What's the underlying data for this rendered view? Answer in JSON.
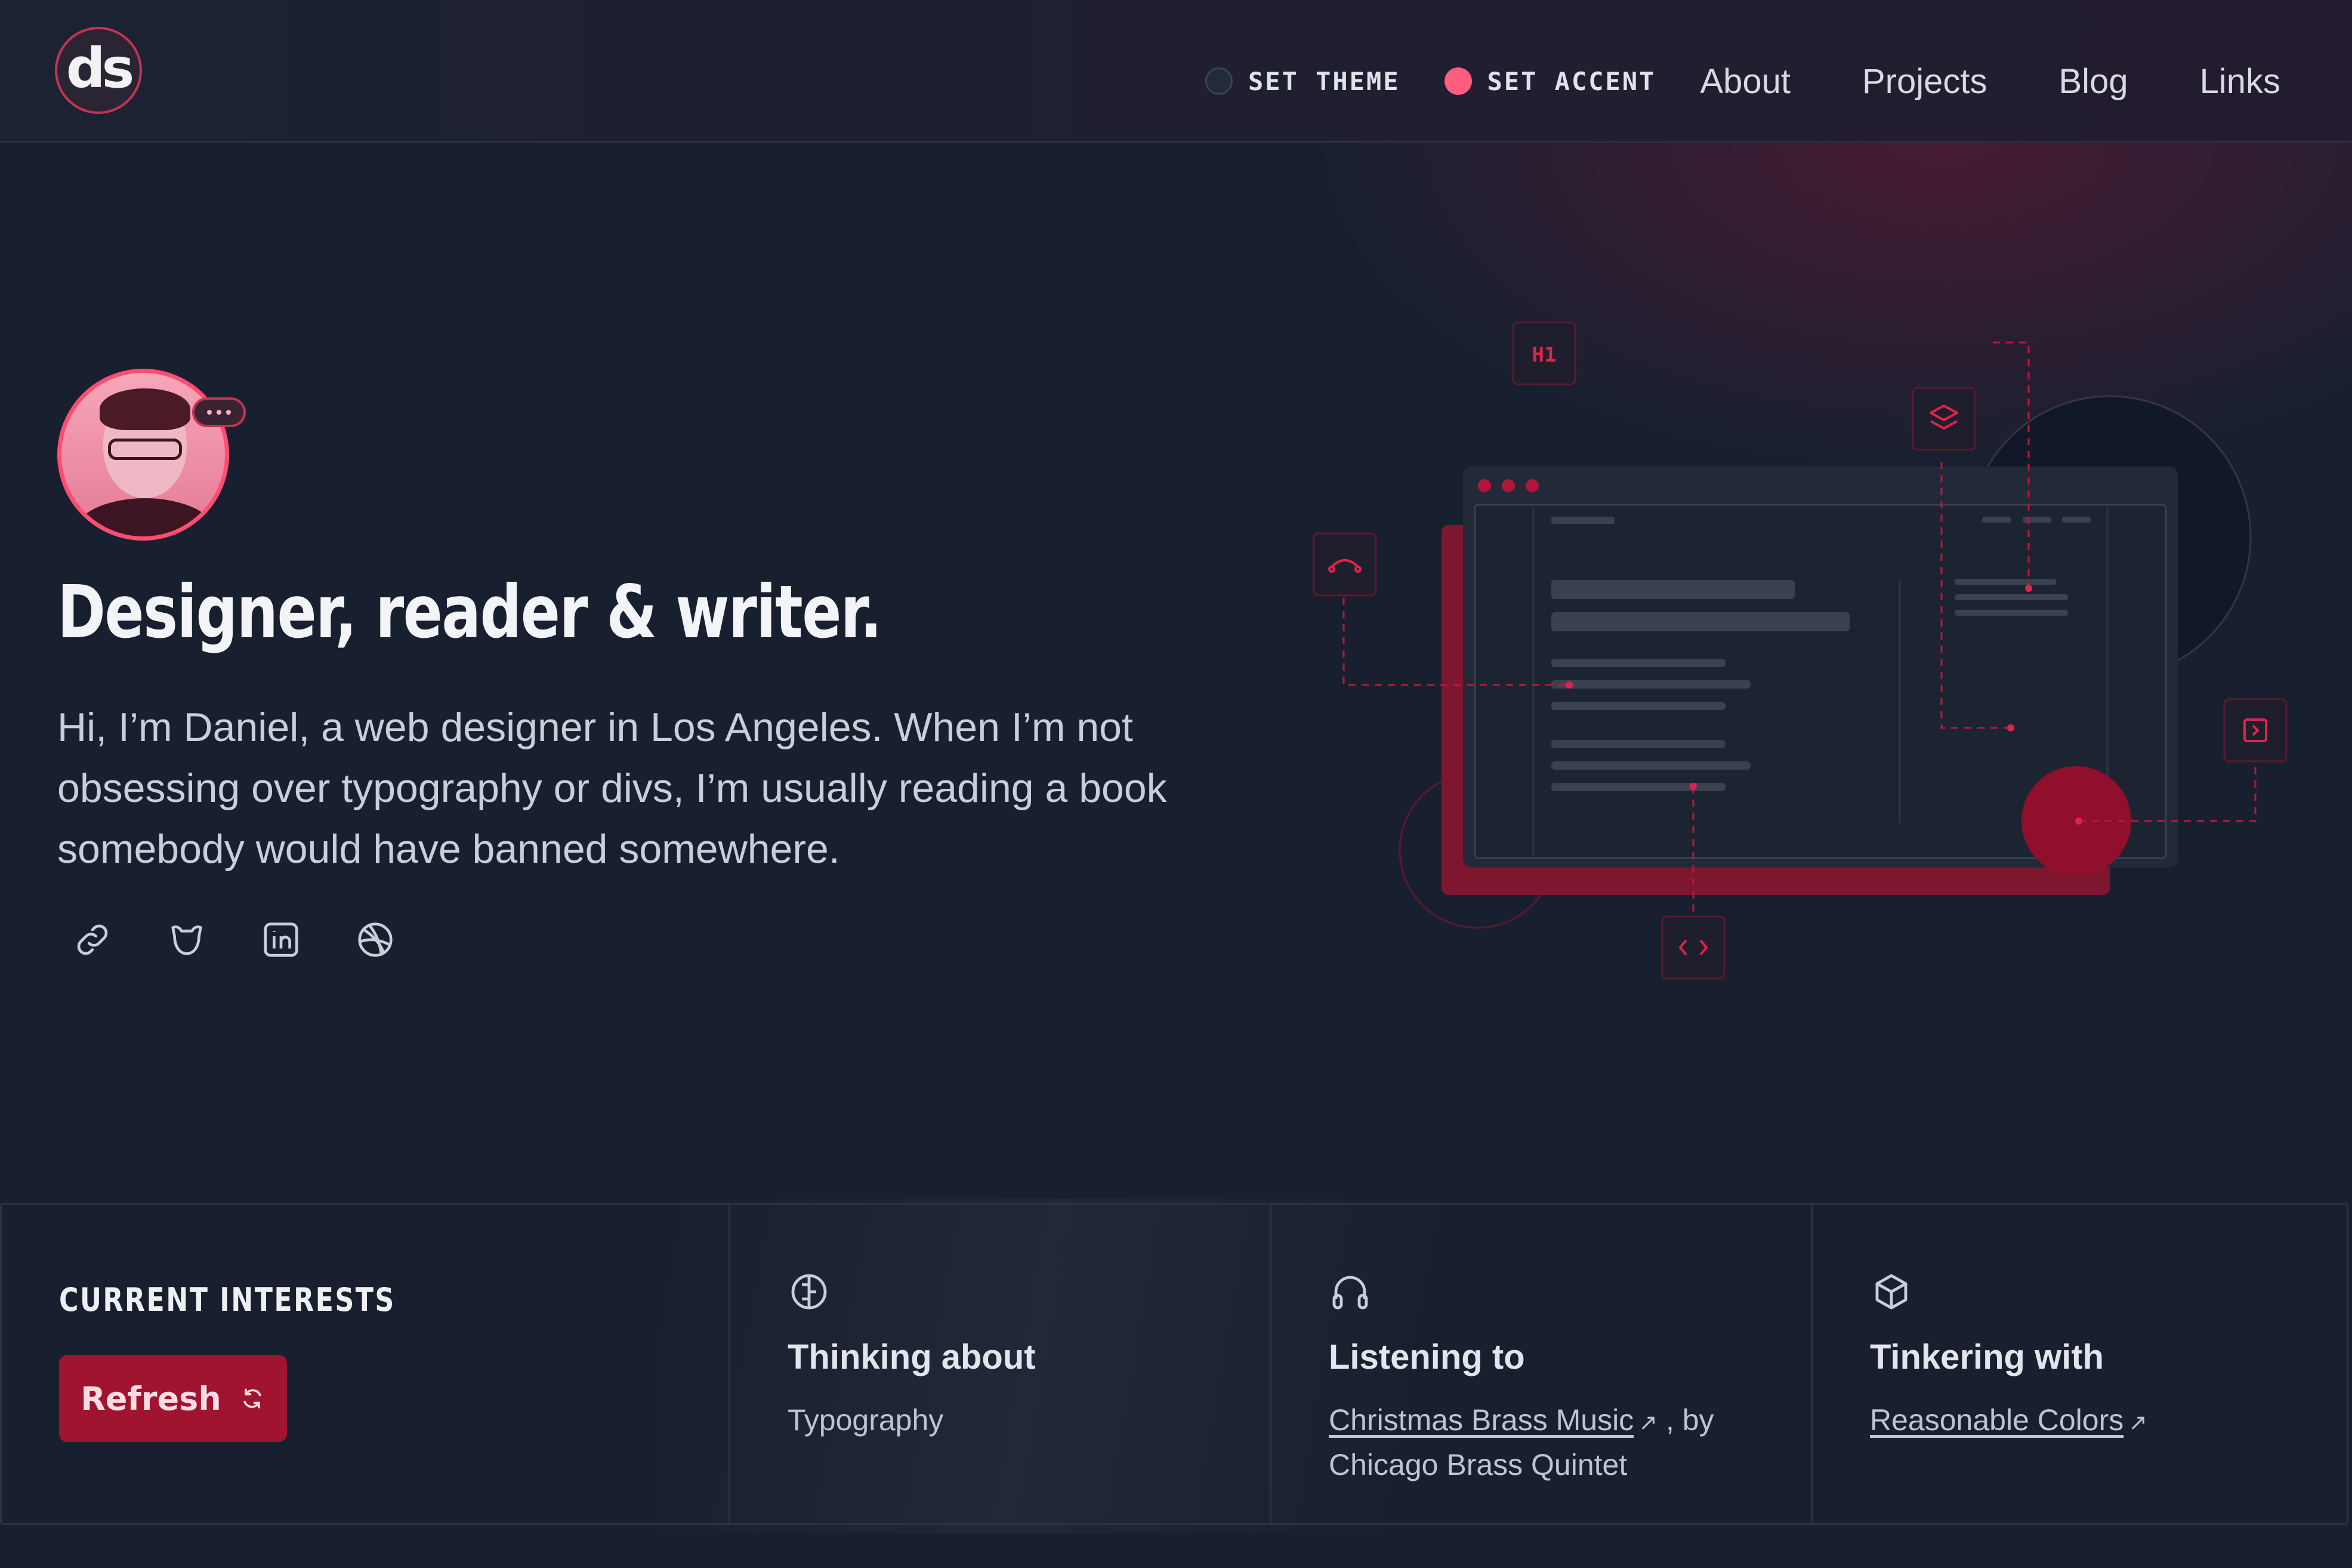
{
  "header": {
    "logo_text": "ds",
    "theme_label": "SET THEME",
    "accent_label": "SET ACCENT",
    "nav": [
      "About",
      "Projects",
      "Blog",
      "Links"
    ],
    "accent_color": "#ff5c7e"
  },
  "hero": {
    "title": "Designer, reader & writer.",
    "intro": "Hi, I’m Daniel, a web designer in Los Angeles. When I’m not obsessing over typography or divs, I’m usually reading a book somebody would have banned somewhere.",
    "socials": [
      "link-icon",
      "mastodon-icon",
      "linkedin-icon",
      "dribbble-icon"
    ],
    "illustration_tag": "H1"
  },
  "interests": {
    "heading": "CURRENT INTERESTS",
    "refresh_label": "Refresh",
    "thinking": {
      "title": "Thinking about",
      "value": "Typography"
    },
    "listening": {
      "title": "Listening to",
      "link": "Christmas Brass Music",
      "sep": ", by",
      "artist": "Chicago Brass Quintet"
    },
    "tinkering": {
      "title": "Tinkering with",
      "link": "Reasonable Colors"
    }
  },
  "colors": {
    "bg": "#18202f",
    "accent": "#c2143a",
    "button": "#a0142f"
  }
}
